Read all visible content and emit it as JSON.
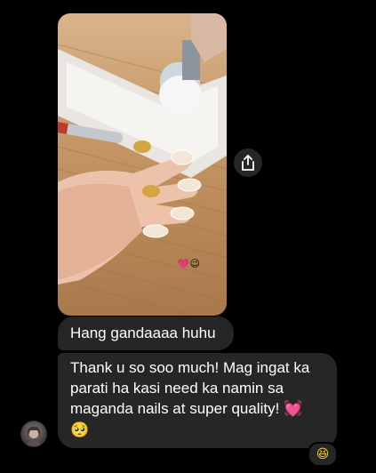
{
  "thread": {
    "photo": {
      "reactions": "💗😉"
    },
    "messages": [
      {
        "text": "Hang gandaaaa huhu"
      },
      {
        "text": "Thank u so soo much! Mag ingat ka parati ha kasi need ka namin sa maganda nails at super quality!",
        "emoji_heart": "💓",
        "emoji_face": "🥺"
      }
    ],
    "message_reaction": "😆"
  },
  "colors": {
    "background": "#000000",
    "bubble": "#262626",
    "text": "#ffffff"
  },
  "icons": {
    "share": "share-icon",
    "avatar": "avatar"
  }
}
